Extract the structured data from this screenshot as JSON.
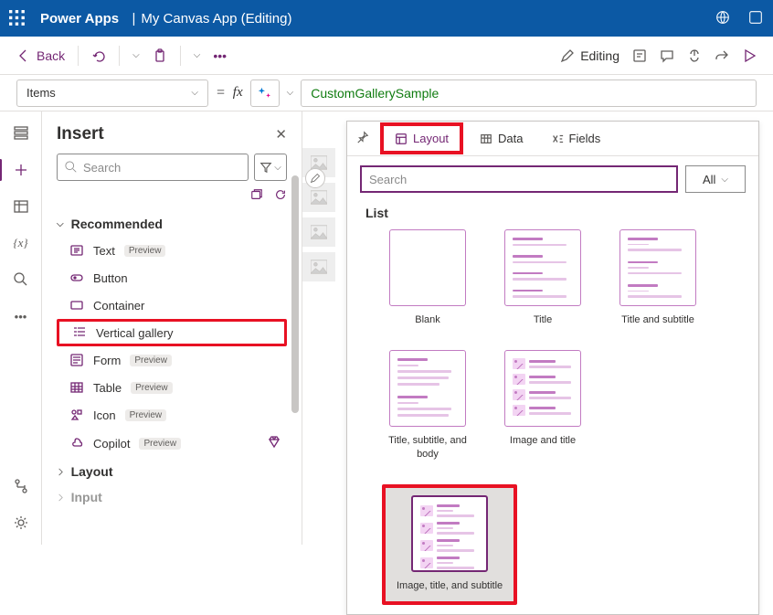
{
  "header": {
    "product": "Power Apps",
    "appName": "My Canvas App (Editing)"
  },
  "cmdBar": {
    "back": "Back",
    "editing": "Editing"
  },
  "formula": {
    "property": "Items",
    "value": "CustomGallerySample"
  },
  "insertPanel": {
    "title": "Insert",
    "searchPlaceholder": "Search",
    "categories": [
      {
        "label": "Recommended",
        "expanded": true,
        "items": [
          {
            "name": "Text",
            "badge": "Preview",
            "icon": "text"
          },
          {
            "name": "Button",
            "icon": "button"
          },
          {
            "name": "Container",
            "icon": "container"
          },
          {
            "name": "Vertical gallery",
            "icon": "vgallery",
            "highlight": true
          },
          {
            "name": "Form",
            "badge": "Preview",
            "icon": "form"
          },
          {
            "name": "Table",
            "badge": "Preview",
            "icon": "table"
          },
          {
            "name": "Icon",
            "badge": "Preview",
            "icon": "icon"
          },
          {
            "name": "Copilot",
            "badge": "Preview",
            "icon": "copilot",
            "premium": true
          }
        ]
      },
      {
        "label": "Layout",
        "expanded": false
      },
      {
        "label": "Input",
        "expanded": false
      }
    ]
  },
  "flyout": {
    "tabs": [
      {
        "label": "Layout",
        "icon": "layout",
        "selected": true,
        "boxed": true
      },
      {
        "label": "Data",
        "icon": "data"
      },
      {
        "label": "Fields",
        "icon": "fields"
      }
    ],
    "searchPlaceholder": "Search",
    "filterLabel": "All",
    "section": "List",
    "tiles": [
      {
        "label": "Blank",
        "type": "blank"
      },
      {
        "label": "Title",
        "type": "title"
      },
      {
        "label": "Title and subtitle",
        "type": "title-sub"
      },
      {
        "label": "Title, subtitle, and body",
        "type": "title-sub-body"
      },
      {
        "label": "Image and title",
        "type": "img-title"
      },
      {
        "label": "Image, title, and subtitle",
        "type": "img-title-sub",
        "selected": true
      }
    ]
  }
}
